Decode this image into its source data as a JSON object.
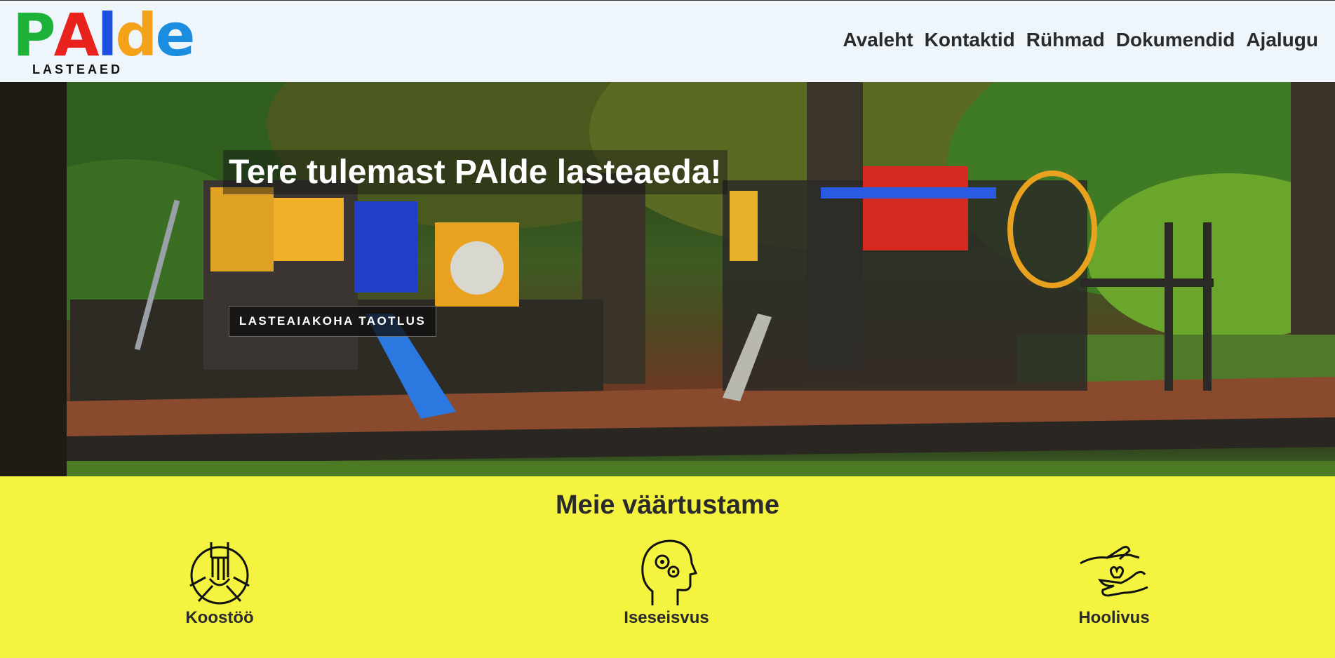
{
  "logo": {
    "letters": [
      {
        "char": "P",
        "color": "#1db33a"
      },
      {
        "char": "A",
        "color": "#e8231d"
      },
      {
        "char": "l",
        "color": "#1e4fe0"
      },
      {
        "char": "d",
        "color": "#f5a21b"
      },
      {
        "char": "e",
        "color": "#1a8de0"
      }
    ],
    "subtitle": "LASTEAED"
  },
  "nav": {
    "items": [
      {
        "label": "Avaleht"
      },
      {
        "label": "Kontaktid"
      },
      {
        "label": "Rühmad"
      },
      {
        "label": "Dokumendid"
      },
      {
        "label": "Ajalugu"
      }
    ]
  },
  "hero": {
    "title": "Tere tulemast PAlde lasteaeda!",
    "button_label": "LASTEAIAKOHA TAOTLUS",
    "image_icon": "playground-photo"
  },
  "values": {
    "title": "Meie väärtustame",
    "items": [
      {
        "label": "Koostöö",
        "icon": "teamwork-hands-icon"
      },
      {
        "label": "Iseseisvus",
        "icon": "head-gears-icon"
      },
      {
        "label": "Hoolivus",
        "icon": "caring-hands-heart-icon"
      }
    ]
  },
  "colors": {
    "header_bg": "#eef6fc",
    "values_bg": "#f4f440",
    "text_dark": "#2a2a2a"
  }
}
